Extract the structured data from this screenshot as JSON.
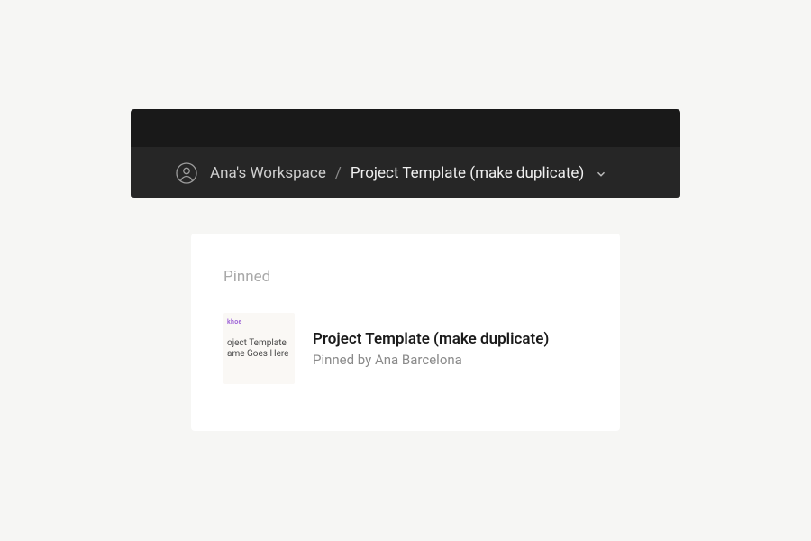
{
  "breadcrumb": {
    "workspace": "Ana's Workspace",
    "separator": "/",
    "current": "Project Template (make duplicate)"
  },
  "pinned": {
    "section_label": "Pinned",
    "item": {
      "title": "Project Template (make duplicate)",
      "subtitle": "Pinned by Ana Barcelona",
      "thumbnail": {
        "tag": "khoe",
        "line1": "oject Template",
        "line2": "ame Goes Here"
      }
    }
  }
}
